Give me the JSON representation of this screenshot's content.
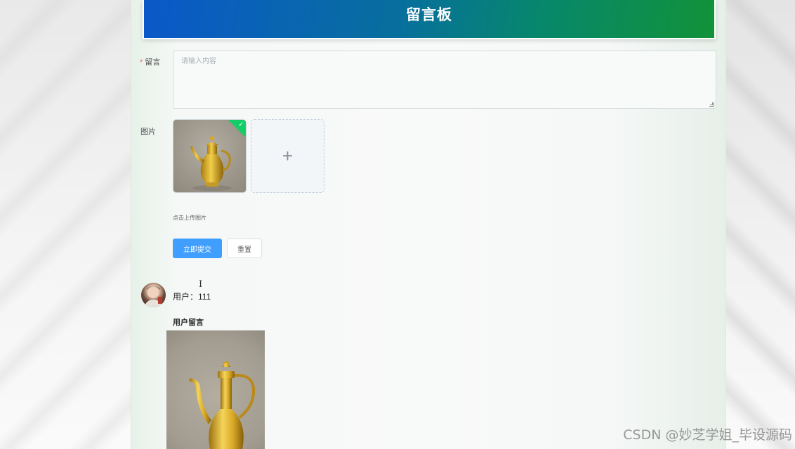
{
  "banner": {
    "title": "留言板"
  },
  "form": {
    "message_label": "留言",
    "required_mark": "*",
    "message_placeholder": "请输入内容",
    "image_label": "图片",
    "upload_plus": "+",
    "upload_hint": "点击上传图片",
    "submit_label": "立即提交",
    "reset_label": "重置"
  },
  "cursor": {
    "glyph": "I"
  },
  "post": {
    "user_text": "用户：111",
    "title": "用户留言"
  },
  "watermark": "CSDN @妙芝学姐_毕设源码",
  "colors": {
    "primary": "#409eff",
    "success": "#13ce66",
    "banner_start": "#0b58c9",
    "banner_end": "#129238"
  },
  "icons": {
    "upload_success": "check-icon",
    "upload_add": "plus-icon"
  }
}
